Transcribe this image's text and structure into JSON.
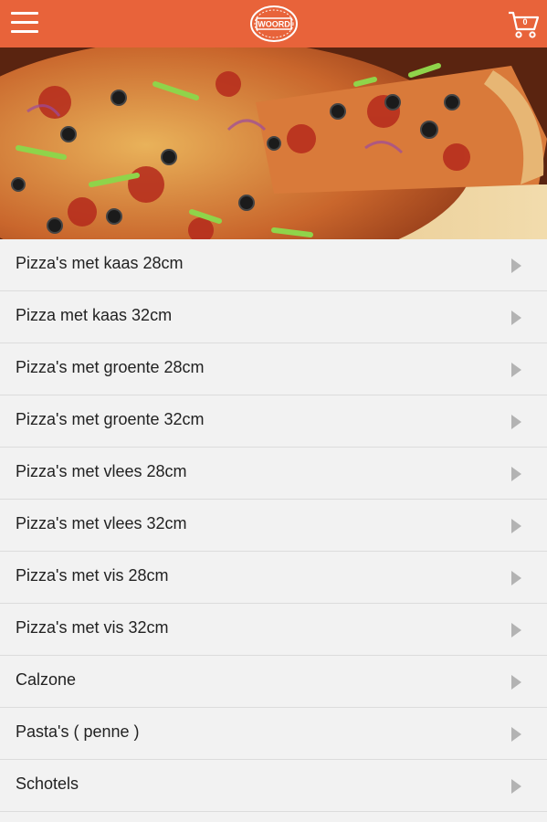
{
  "header": {
    "menu_icon": "hamburger-menu-icon",
    "logo_text": "WOORD",
    "cart_icon": "shopping-cart-icon",
    "cart_count": "0",
    "brand_color": "#e8633a"
  },
  "hero": {
    "image": "pizza-banner-image"
  },
  "categories": [
    {
      "label": "Pizza's met kaas 28cm"
    },
    {
      "label": "Pizza met kaas 32cm"
    },
    {
      "label": "Pizza's met groente 28cm"
    },
    {
      "label": "Pizza's met groente 32cm"
    },
    {
      "label": "Pizza's met vlees 28cm"
    },
    {
      "label": "Pizza's met vlees 32cm"
    },
    {
      "label": "Pizza's met vis 28cm"
    },
    {
      "label": "Pizza's met vis 32cm"
    },
    {
      "label": "Calzone"
    },
    {
      "label": "Pasta's ( penne )"
    },
    {
      "label": "Schotels"
    }
  ]
}
